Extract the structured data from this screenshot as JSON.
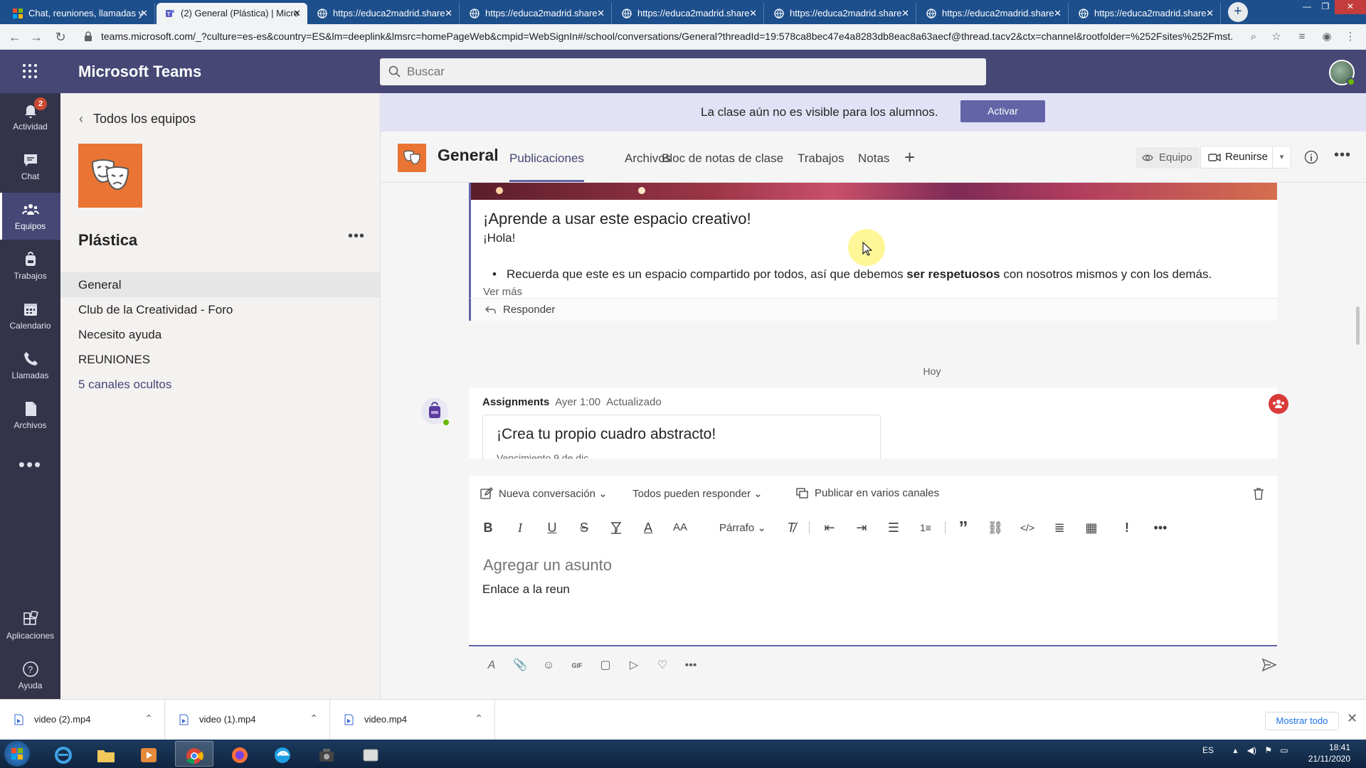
{
  "browser": {
    "tabs": [
      {
        "label": "Chat, reuniones, llamadas y",
        "icon": "microsoft-logo"
      },
      {
        "label": "(2) General (Plástica) | Micro",
        "icon": "teams-logo"
      },
      {
        "label": "https://educa2madrid.share",
        "icon": "globe"
      },
      {
        "label": "https://educa2madrid.share",
        "icon": "globe"
      },
      {
        "label": "https://educa2madrid.share",
        "icon": "globe"
      },
      {
        "label": "https://educa2madrid.share",
        "icon": "globe"
      },
      {
        "label": "https://educa2madrid.share",
        "icon": "globe"
      },
      {
        "label": "https://educa2madrid.share",
        "icon": "globe"
      }
    ],
    "active_tab": 1,
    "url": "teams.microsoft.com/_?culture=es-es&country=ES&lm=deeplink&lmsrc=homePageWeb&cmpid=WebSignIn#/school/conversations/General?threadId=19:578ca8bec47e4a8283db8eac8a63aecf@thread.tacv2&ctx=channel&rootfolder=%252Fsites%252Fmst..."
  },
  "header": {
    "app_title": "Microsoft Teams",
    "search_placeholder": "Buscar"
  },
  "rail": {
    "items": [
      {
        "label": "Actividad",
        "icon": "bell-icon",
        "badge": "2"
      },
      {
        "label": "Chat",
        "icon": "chat-icon"
      },
      {
        "label": "Equipos",
        "icon": "teams-icon",
        "active": true
      },
      {
        "label": "Trabajos",
        "icon": "backpack-icon"
      },
      {
        "label": "Calendario",
        "icon": "calendar-icon"
      },
      {
        "label": "Llamadas",
        "icon": "phone-icon"
      },
      {
        "label": "Archivos",
        "icon": "file-icon"
      }
    ],
    "more": "•••",
    "apps_label": "Aplicaciones",
    "help_label": "Ayuda"
  },
  "sidebar": {
    "back_label": "Todos los equipos",
    "team_name": "Plástica",
    "more": "•••",
    "channels": [
      {
        "label": "General",
        "selected": true
      },
      {
        "label": "Club de la Creatividad - Foro"
      },
      {
        "label": "Necesito ayuda"
      },
      {
        "label": "REUNIONES"
      },
      {
        "label": "5 canales ocultos",
        "hidden": true
      }
    ]
  },
  "banner": {
    "text": "La clase aún no es visible para los alumnos.",
    "button": "Activar"
  },
  "channel_header": {
    "name": "General",
    "tabs": [
      "Publicaciones",
      "Archivos",
      "Bloc de notas de clase",
      "Trabajos",
      "Notas"
    ],
    "active_tab": 0,
    "add": "+",
    "team_button": "Equipo",
    "meet_button": "Reunirse",
    "more": "•••"
  },
  "post": {
    "title": "¡Aprende a usar este espacio creativo!",
    "greeting": "¡Hola!",
    "bullet_before": "Recuerda que este es un espacio compartido por todos, así que debemos ",
    "bullet_bold": "ser respetuosos",
    "bullet_after": " con nosotros mismos y con los demás.",
    "see_more": "Ver más",
    "reply": "Responder"
  },
  "day_separator": "Hoy",
  "assignment_post": {
    "author": "Assignments",
    "time": "Ayer 1:00",
    "status": "Actualizado",
    "card_title": "¡Crea tu propio cuadro abstracto!",
    "due": "Vencimiento 9 de dic"
  },
  "compose": {
    "new_conversation": "Nueva conversación",
    "who_can_reply": "Todos pueden responder",
    "post_multiple": "Publicar en varios canales",
    "paragraph": "Párrafo",
    "subject_placeholder": "Agregar un asunto",
    "body": "Enlace a la reun"
  },
  "downloads": {
    "items": [
      "video (2).mp4",
      "video (1).mp4",
      "video.mp4"
    ],
    "show_all": "Mostrar todo"
  },
  "taskbar": {
    "lang": "ES",
    "time": "18:41",
    "date": "21/11/2020"
  },
  "colors": {
    "teams_purple": "#6264a7",
    "header_purple": "#464775",
    "rail": "#33344a",
    "team_logo_orange": "#e97433"
  }
}
